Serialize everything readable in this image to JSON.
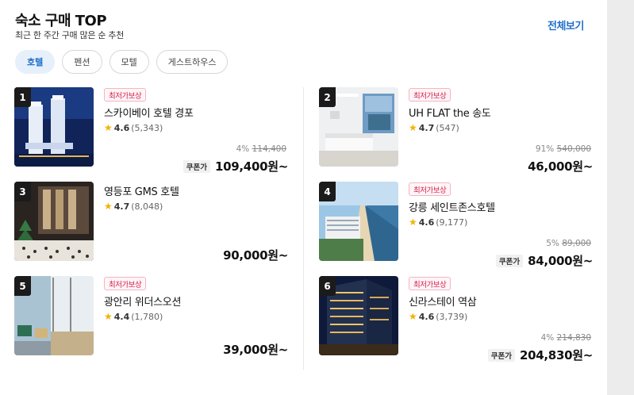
{
  "header": {
    "title": "숙소 구매 TOP",
    "subtitle": "최근 한 주간 구매 많은 순 추천",
    "see_all": "전체보기"
  },
  "tabs": [
    {
      "label": "호텔",
      "active": true
    },
    {
      "label": "펜션",
      "active": false
    },
    {
      "label": "모텔",
      "active": false
    },
    {
      "label": "게스트하우스",
      "active": false
    }
  ],
  "items": [
    {
      "rank": "1",
      "badge": "최저가보상",
      "name": "스카이베이 호텔 경포",
      "rating": "4.6",
      "reviews": "(5,343)",
      "discount_pct": "4%",
      "original_price": "114,400",
      "coupon": "쿠폰가",
      "price": "109,400원~",
      "image": "hotel-towers-night"
    },
    {
      "rank": "2",
      "badge": "최저가보상",
      "name": "UH FLAT the 송도",
      "rating": "4.7",
      "reviews": "(547)",
      "discount_pct": "91%",
      "original_price": "540,000",
      "coupon": "",
      "price": "46,000원~",
      "image": "bright-bedroom"
    },
    {
      "rank": "3",
      "badge": "",
      "name": "영등포 GMS 호텔",
      "rating": "4.7",
      "reviews": "(8,048)",
      "discount_pct": "",
      "original_price": "",
      "coupon": "",
      "price": "90,000원~",
      "image": "lobby-tree"
    },
    {
      "rank": "4",
      "badge": "최저가보상",
      "name": "강릉 세인트존스호텔",
      "rating": "4.6",
      "reviews": "(9,177)",
      "discount_pct": "5%",
      "original_price": "89,000",
      "coupon": "쿠폰가",
      "price": "84,000원~",
      "image": "beach-aerial"
    },
    {
      "rank": "5",
      "badge": "최저가보상",
      "name": "광안리 위더스오션",
      "rating": "4.4",
      "reviews": "(1,780)",
      "discount_pct": "",
      "original_price": "",
      "coupon": "",
      "price": "39,000원~",
      "image": "balcony-chairs"
    },
    {
      "rank": "6",
      "badge": "최저가보상",
      "name": "신라스테이 역삼",
      "rating": "4.6",
      "reviews": "(3,739)",
      "discount_pct": "4%",
      "original_price": "214,830",
      "coupon": "쿠폰가",
      "price": "204,830원~",
      "image": "building-night"
    }
  ],
  "colors": {
    "accent": "#1f6fc9",
    "badge": "#d4214e",
    "star": "#f2b300"
  }
}
